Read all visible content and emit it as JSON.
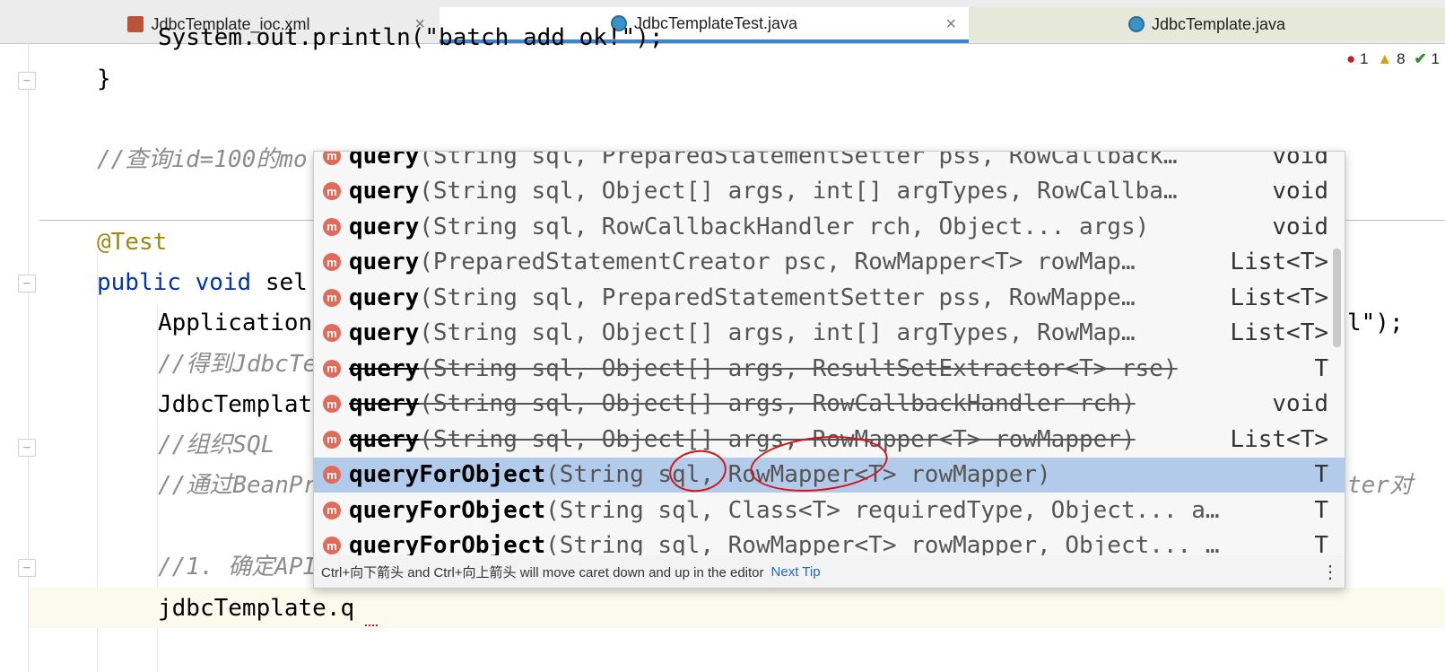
{
  "tabs": [
    {
      "label": "JdbcTemplate_ioc.xml",
      "close": "×"
    },
    {
      "label": "JdbcTemplateTest.java",
      "close": "×"
    },
    {
      "label": "JdbcTemplate.java"
    }
  ],
  "inspections": {
    "errors": "1",
    "warnings": "8",
    "ok": "1"
  },
  "code": {
    "line0": "System.out.println(\"batch add ok!\");",
    "line1": "}",
    "line2": "//查询id=100的mo",
    "line3": "@Test",
    "line4_kw": "public void",
    "line4_rest": " sel",
    "line5": "Application",
    "line5_tail": "l\");",
    "line6": "//得到JdbcTe",
    "line7": "JdbcTemplat",
    "line8": "//组织SQL",
    "line9": "//通过BeanPr",
    "line9_tail": "ter对",
    "line10": "//1. 确定API",
    "line11": "jdbcTemplate.q"
  },
  "completion": {
    "items": [
      {
        "name": "query",
        "params": "(String sql, PreparedStatementSetter pss, RowCallback…",
        "ret": "void"
      },
      {
        "name": "query",
        "params": "(String sql, Object[] args, int[] argTypes, RowCallba…",
        "ret": "void"
      },
      {
        "name": "query",
        "params": "(String sql, RowCallbackHandler rch, Object... args)",
        "ret": "void"
      },
      {
        "name": "query",
        "params": "(PreparedStatementCreator psc, RowMapper<T> rowMap…",
        "ret": "List<T>"
      },
      {
        "name": "query",
        "params": "(String sql, PreparedStatementSetter pss, RowMappe…",
        "ret": "List<T>"
      },
      {
        "name": "query",
        "params": "(String sql, Object[] args, int[] argTypes, RowMap…",
        "ret": "List<T>"
      },
      {
        "name": "query",
        "params": "(String sql, Object[] args, ResultSetExtractor<T> rse)",
        "ret": "T"
      },
      {
        "name": "query",
        "params": "(String sql, Object[] args, RowCallbackHandler rch)",
        "ret": "void"
      },
      {
        "name": "query",
        "params": "(String sql, Object[] args, RowMapper<T> rowMapper)",
        "ret": "List<T>"
      },
      {
        "name": "queryForObject",
        "params": "(String sql, RowMapper<T> rowMapper)",
        "ret": "T"
      },
      {
        "name": "queryForObject",
        "params": "(String sql, Class<T> requiredType, Object... a…",
        "ret": "T"
      },
      {
        "name": "queryForObject",
        "params": "(String sql, RowMapper<T> rowMapper, Object... …",
        "ret": "T"
      }
    ],
    "footer_text": "Ctrl+向下箭头 and Ctrl+向上箭头 will move caret down and up in the editor",
    "footer_link": "Next Tip",
    "footer_menu": "⋮",
    "method_icon": "m"
  }
}
